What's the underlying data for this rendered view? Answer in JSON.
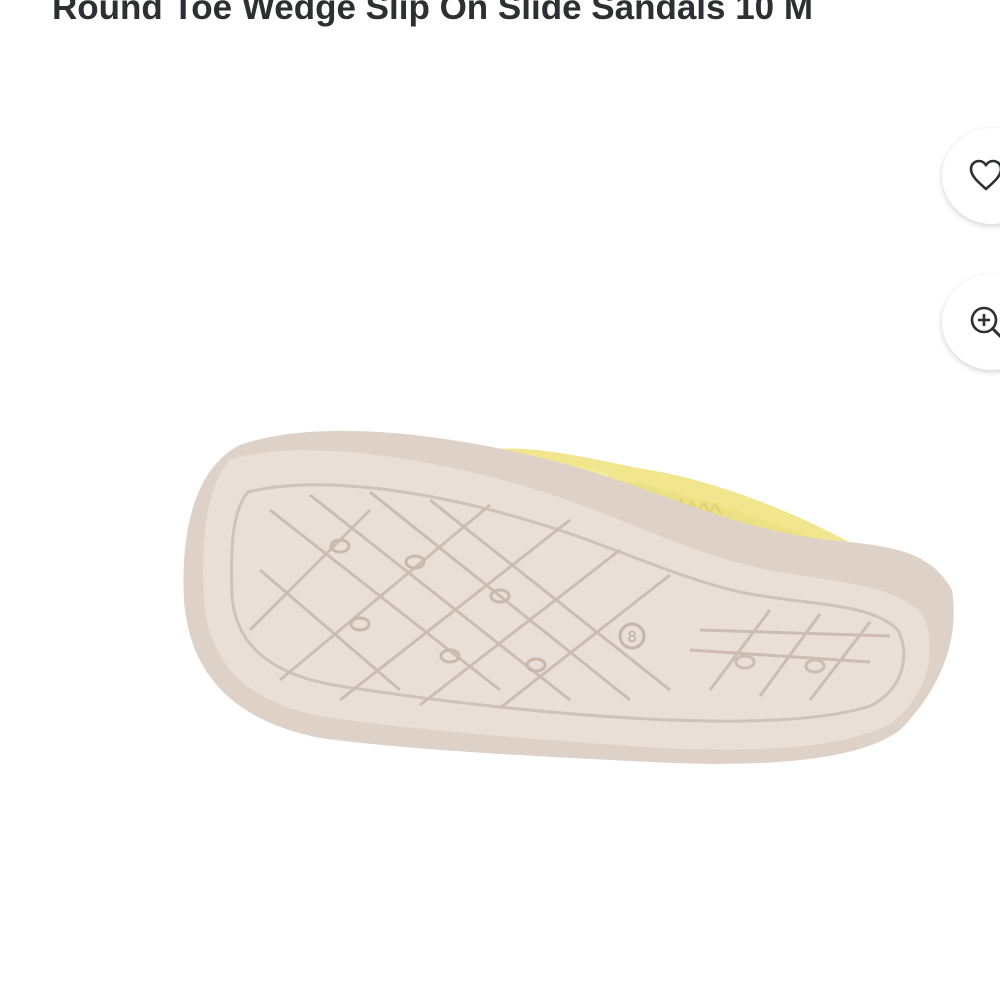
{
  "product": {
    "title_line_1": "",
    "title_line_2": "Round Toe Wedge Slip On Slide Sandals 10 M"
  },
  "image": {
    "subject": "sandal-sole",
    "sole_color": "#e8ddd5",
    "strap_color": "#f0e48a",
    "size_mark": "8"
  },
  "actions": {
    "favorite_icon": "heart-icon",
    "zoom_icon": "zoom-in-icon"
  },
  "colors": {
    "text": "#2e2f32",
    "button_bg": "#ffffff"
  }
}
